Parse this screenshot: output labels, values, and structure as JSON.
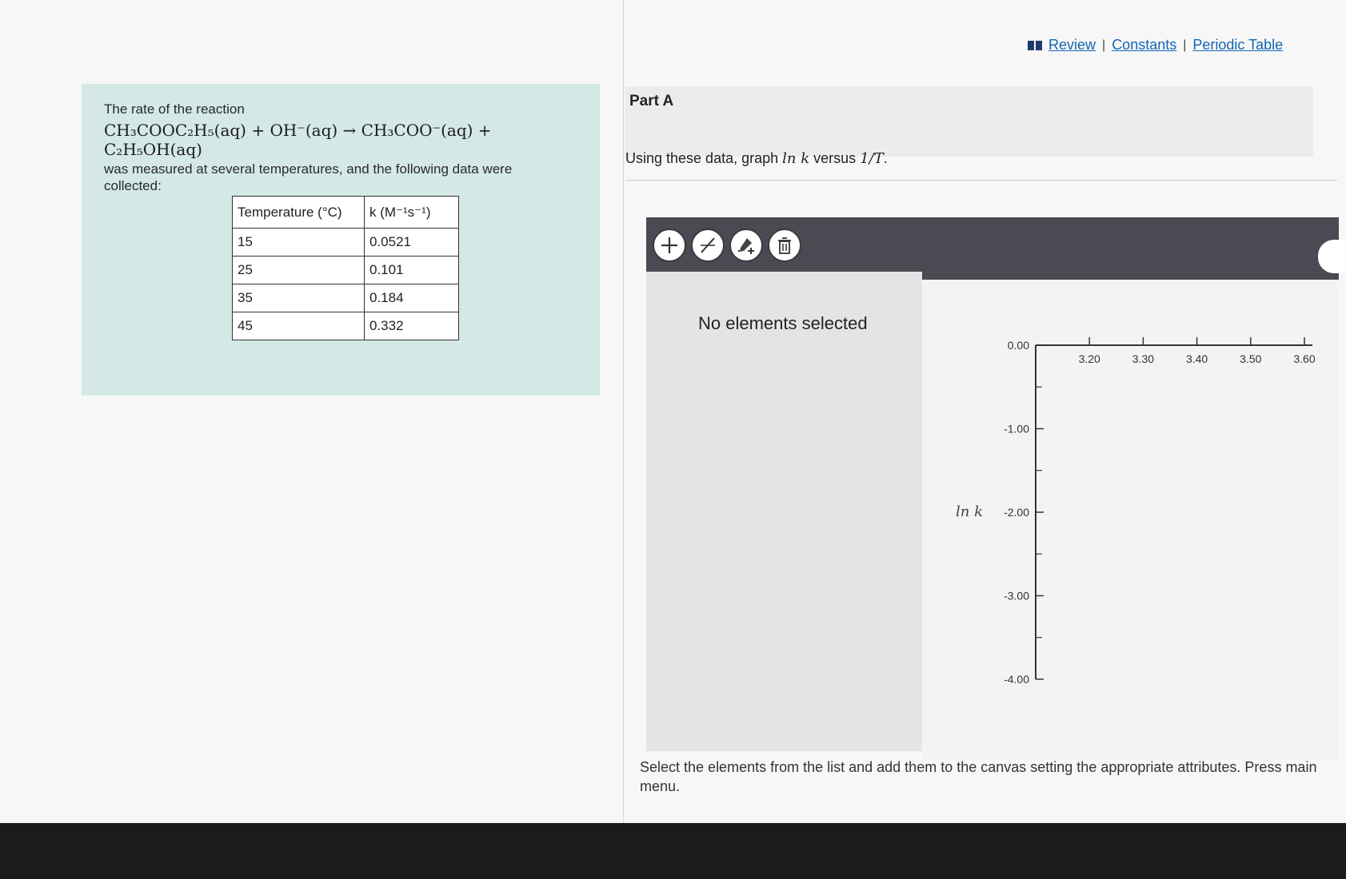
{
  "top_links": {
    "icon": "book-icon",
    "review": "Review",
    "constants": "Constants",
    "periodic_table": "Periodic Table",
    "separator": "|"
  },
  "problem": {
    "intro": "The rate of the reaction",
    "equation": {
      "reactant1": "CH₃COOC₂H₅(aq)",
      "plus1": "+",
      "reactant2": "OH⁻(aq)",
      "arrow": "→",
      "product1": "CH₃COO⁻(aq)",
      "plus2": "+",
      "product2": "C₂H₅OH(aq)"
    },
    "description": "was measured at several temperatures, and the following data were collected:",
    "table": {
      "headers": [
        "Temperature (°C)",
        "k (M⁻¹s⁻¹)"
      ],
      "rows": [
        [
          "15",
          "0.0521"
        ],
        [
          "25",
          "0.101"
        ],
        [
          "35",
          "0.184"
        ],
        [
          "45",
          "0.332"
        ]
      ]
    }
  },
  "part": {
    "title": "Part A",
    "prompt_text": "Using these data, graph",
    "prompt_math1": "ln k",
    "prompt_mid": "versus",
    "prompt_math2": "1/T",
    "prompt_end": "."
  },
  "toolbar": {
    "buttons": [
      "plus-icon",
      "line-tool-icon",
      "add-point-icon",
      "trash-icon"
    ]
  },
  "elements_panel": {
    "message": "No elements selected"
  },
  "graph": {
    "y_label": "ln k",
    "y_ticks": [
      "0.00",
      "-1.00",
      "-2.00",
      "-3.00",
      "-4.00"
    ],
    "x_ticks": [
      "3.20",
      "3.30",
      "3.40",
      "3.50",
      "3.60"
    ]
  },
  "footer": {
    "text": "Select the elements from the list and add them to the canvas setting the appropriate attributes. Press main menu."
  }
}
